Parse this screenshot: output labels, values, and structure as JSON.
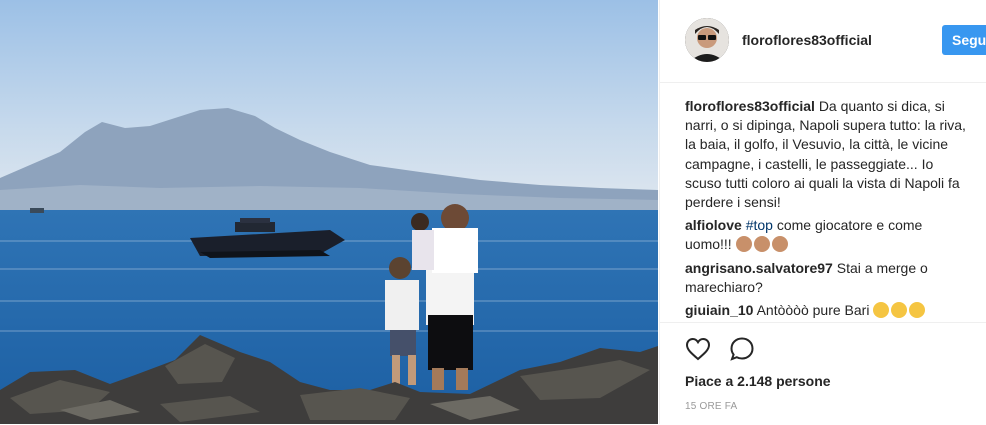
{
  "post": {
    "username": "floroflores83official",
    "follow_label": "Segui",
    "caption": {
      "user": "floroflores83official",
      "text": "Da quanto si dica, si narri, o si dipinga, Napoli supera tutto: la riva, la baia, il golfo, il Vesuvio, la città, le vicine campagne, i castelli, le passeggiate... Io scuso tutti coloro ai quali la vista di Napoli fa perdere i sensi!"
    },
    "comments": [
      {
        "user": "alfiolove",
        "hashtag": "#top",
        "text": " come giocatore e come uomo!!!",
        "emoji": [
          "clap",
          "clap",
          "clap"
        ]
      },
      {
        "user": "angrisano.salvatore97",
        "text": "Stai a merge o marechiaro?"
      },
      {
        "user": "giuiain_10",
        "text": "Antòòòò pure Bari",
        "emoji": [
          "laugh",
          "laugh",
          "laugh"
        ]
      }
    ],
    "likes_text": "Piace a 2.148 persone",
    "time_ago": "15 ORE FA",
    "icons": {
      "like": "heart-icon",
      "comment": "comment-icon"
    },
    "colors": {
      "accent": "#3897f0",
      "hashtag": "#003569",
      "text": "#262626",
      "muted": "#999999"
    }
  }
}
